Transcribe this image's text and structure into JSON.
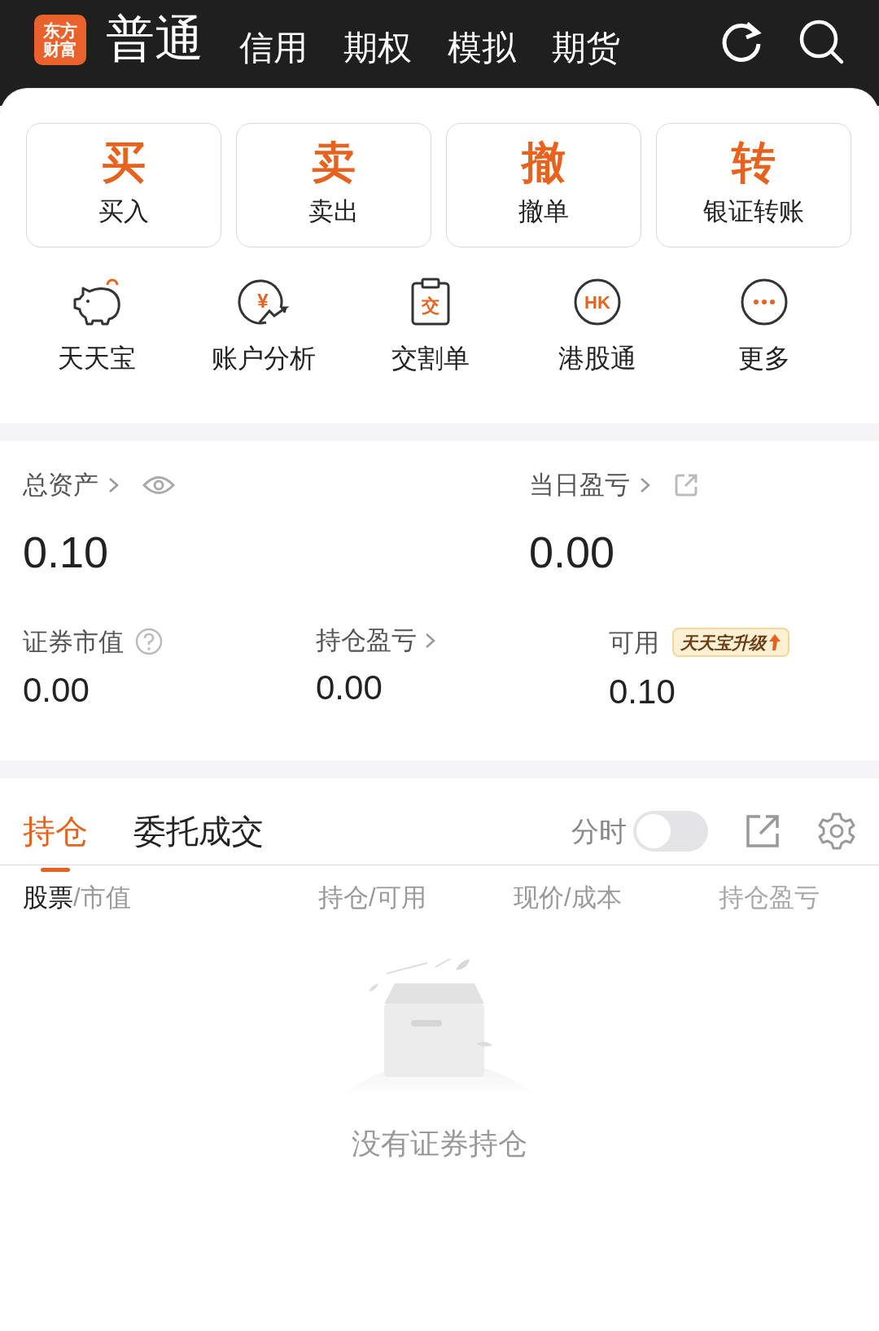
{
  "header": {
    "logo": [
      "东方",
      "财富"
    ],
    "tabs": [
      {
        "label": "普通",
        "selected": true
      },
      {
        "label": "信用",
        "selected": false
      },
      {
        "label": "期权",
        "selected": false
      },
      {
        "label": "模拟",
        "selected": false
      },
      {
        "label": "期货",
        "selected": false
      }
    ]
  },
  "actions": [
    {
      "glyph": "买",
      "label": "买入"
    },
    {
      "glyph": "卖",
      "label": "卖出"
    },
    {
      "glyph": "撤",
      "label": "撤单"
    },
    {
      "glyph": "转",
      "label": "银证转账"
    }
  ],
  "shortcuts": [
    {
      "kind": "piggy",
      "label": "天天宝"
    },
    {
      "kind": "yuan",
      "icon_text": "¥",
      "label": "账户分析"
    },
    {
      "kind": "clipboard",
      "icon_text": "交",
      "label": "交割单"
    },
    {
      "kind": "circle",
      "icon_text": "HK",
      "label": "港股通"
    },
    {
      "kind": "more",
      "label": "更多"
    }
  ],
  "assets": {
    "total": {
      "label": "总资产",
      "value": "0.10"
    },
    "daily_pnl": {
      "label": "当日盈亏",
      "value": "0.00"
    },
    "market_value": {
      "label": "证券市值",
      "value": "0.00"
    },
    "position_pnl": {
      "label": "持仓盈亏",
      "value": "0.00"
    },
    "available": {
      "label": "可用",
      "badge": "天天宝升级",
      "value": "0.10"
    }
  },
  "positions": {
    "tabs": [
      {
        "label": "持仓",
        "selected": true
      },
      {
        "label": "委托成交",
        "selected": false
      }
    ],
    "toggle": {
      "label": "分时",
      "on": false
    },
    "columns": [
      {
        "label": "股票",
        "suffix": "/市值",
        "active": true
      },
      {
        "label": "持仓/可用",
        "active": false
      },
      {
        "label": "现价/成本",
        "active": false
      },
      {
        "label": "持仓盈亏",
        "active": false
      }
    ],
    "empty_text": "没有证券持仓"
  }
}
